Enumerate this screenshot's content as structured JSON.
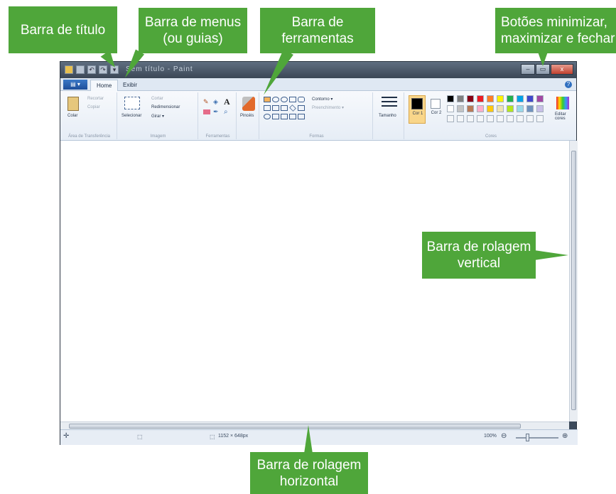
{
  "callouts": {
    "title_bar": "Barra de título",
    "menu_bar_l1": "Barra de menus",
    "menu_bar_l2": "(ou guias)",
    "toolbar_l1": "Barra de",
    "toolbar_l2": "ferramentas",
    "window_buttons_l1": "Botões minimizar,",
    "window_buttons_l2": "maximizar e fechar",
    "vscroll_l1": "Barra de rolagem",
    "vscroll_l2": "vertical",
    "hscroll_l1": "Barra de rolagem",
    "hscroll_l2": "horizontal"
  },
  "window": {
    "title": "Sem título - Paint",
    "minimize_glyph": "–",
    "maximize_glyph": "▭",
    "close_glyph": "x"
  },
  "menu": {
    "file_label": "▤ ▾",
    "tabs": [
      "Home",
      "Exibir"
    ],
    "help_glyph": "?"
  },
  "ribbon": {
    "clipboard": {
      "paste": "Colar",
      "cut": "Recortar",
      "copy": "Copiar",
      "label": "Área de Transferência"
    },
    "image": {
      "select": "Selecionar",
      "crop": "Cortar",
      "resize": "Redimensionar",
      "rotate": "Girar ▾",
      "label": "Imagem"
    },
    "tools": {
      "label": "Ferramentas",
      "text_glyph": "A"
    },
    "brushes": {
      "label": "Pincéis"
    },
    "shapes": {
      "outline": "Contorno ▾",
      "fill": "Preenchimento ▾",
      "label": "Formas"
    },
    "size": {
      "label": "Tamanho"
    },
    "colors": {
      "color1": "Cor 1",
      "color2": "Cor 2",
      "edit": "Editar cores",
      "label": "Cores",
      "color1_value": "#000000",
      "color2_value": "#ffffff",
      "palette_row1": [
        "#000000",
        "#7f7f7f",
        "#880015",
        "#ed1c24",
        "#ff7f27",
        "#fff200",
        "#22b14c",
        "#00a2e8",
        "#3f48cc",
        "#a349a4"
      ],
      "palette_row2": [
        "#ffffff",
        "#c3c3c3",
        "#b97a57",
        "#ffaec9",
        "#ffc90e",
        "#efe4b0",
        "#b5e61d",
        "#99d9ea",
        "#7092be",
        "#c8bfe7"
      ]
    }
  },
  "status": {
    "canvas_size": "1152 × 648px",
    "zoom": "100%",
    "zoom_out": "⊖",
    "zoom_in": "⊕"
  },
  "colors": {
    "callout": "#4fa63a",
    "window_frame": "#3d4b5c"
  }
}
